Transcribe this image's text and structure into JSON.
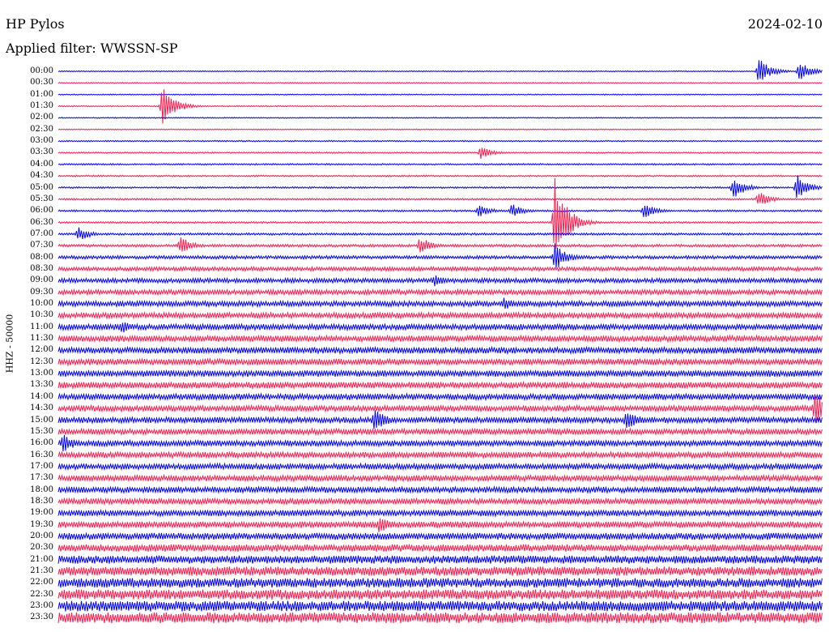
{
  "header": {
    "station": "HP Pylos",
    "date": "2024-02-10",
    "filter_label": "Applied filter: WWSSN-SP"
  },
  "chart_data": {
    "type": "line",
    "title": "HP Pylos",
    "subtitle": "Applied filter: WWSSN-SP",
    "ylabel": "HHZ - 50000",
    "date": "2024-02-10",
    "trace_colors": [
      "#0000ff",
      "#ff1a4d"
    ],
    "rows": [
      "00:00",
      "00:30",
      "01:00",
      "01:30",
      "02:00",
      "02:30",
      "03:00",
      "03:30",
      "04:00",
      "04:30",
      "05:00",
      "05:30",
      "06:00",
      "06:30",
      "07:00",
      "07:30",
      "08:00",
      "08:30",
      "09:00",
      "09:30",
      "10:00",
      "10:30",
      "11:00",
      "11:30",
      "12:00",
      "12:30",
      "13:00",
      "13:30",
      "14:00",
      "14:30",
      "15:00",
      "15:30",
      "16:00",
      "16:30",
      "17:00",
      "17:30",
      "18:00",
      "18:30",
      "19:00",
      "19:30",
      "20:00",
      "20:30",
      "21:00",
      "21:30",
      "22:00",
      "22:30",
      "23:00",
      "23:30"
    ],
    "noise_level": [
      0.5,
      0.5,
      0.5,
      0.5,
      0.5,
      0.5,
      0.6,
      0.6,
      0.7,
      0.7,
      0.8,
      0.8,
      0.8,
      0.8,
      1.0,
      1.2,
      1.5,
      1.8,
      2.0,
      2.2,
      2.4,
      2.5,
      2.6,
      2.7,
      2.8,
      2.8,
      2.8,
      2.8,
      2.7,
      2.6,
      2.6,
      2.6,
      2.6,
      2.6,
      2.6,
      2.6,
      2.6,
      2.6,
      2.7,
      2.8,
      3.0,
      3.2,
      3.6,
      4.0,
      4.2,
      4.4,
      4.6,
      4.8
    ],
    "events": [
      {
        "row": 0,
        "minute": 27.5,
        "amplitude": 16
      },
      {
        "row": 0,
        "minute": 29.1,
        "amplitude": 12
      },
      {
        "row": 3,
        "minute": 4.1,
        "amplitude": 28
      },
      {
        "row": 7,
        "minute": 16.6,
        "amplitude": 8
      },
      {
        "row": 10,
        "minute": 26.5,
        "amplitude": 14
      },
      {
        "row": 10,
        "minute": 29.0,
        "amplitude": 16
      },
      {
        "row": 11,
        "minute": 27.5,
        "amplitude": 10
      },
      {
        "row": 12,
        "minute": 16.5,
        "amplitude": 8
      },
      {
        "row": 12,
        "minute": 17.8,
        "amplitude": 9
      },
      {
        "row": 12,
        "minute": 23.0,
        "amplitude": 10
      },
      {
        "row": 13,
        "minute": 19.5,
        "amplitude": 60
      },
      {
        "row": 14,
        "minute": 0.8,
        "amplitude": 9
      },
      {
        "row": 15,
        "minute": 4.8,
        "amplitude": 12
      },
      {
        "row": 15,
        "minute": 14.2,
        "amplitude": 12
      },
      {
        "row": 16,
        "minute": 19.5,
        "amplitude": 18
      },
      {
        "row": 18,
        "minute": 14.8,
        "amplitude": 9
      },
      {
        "row": 20,
        "minute": 17.5,
        "amplitude": 9
      },
      {
        "row": 22,
        "minute": 2.5,
        "amplitude": 8
      },
      {
        "row": 30,
        "minute": 12.4,
        "amplitude": 16
      },
      {
        "row": 30,
        "minute": 22.3,
        "amplitude": 14
      },
      {
        "row": 32,
        "minute": 0.2,
        "amplitude": 12
      },
      {
        "row": 39,
        "minute": 12.6,
        "amplitude": 12
      },
      {
        "row": 29,
        "minute": 29.7,
        "amplitude": 22
      }
    ]
  }
}
